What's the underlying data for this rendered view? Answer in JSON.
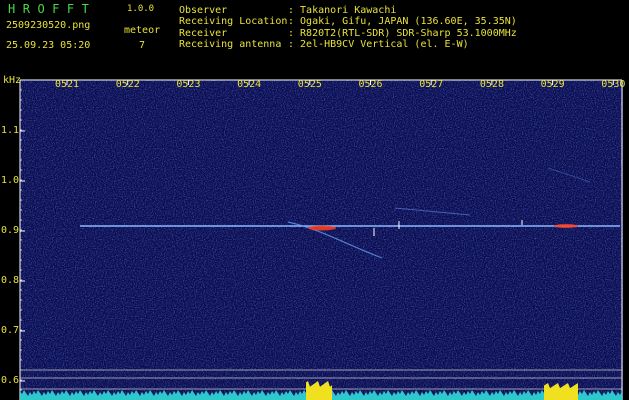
{
  "header": {
    "brand": "HROFFT",
    "version": "1.0.0",
    "filename": "2509230520.png",
    "meteor_label": "meteor",
    "datetime": "25.09.23 05:20",
    "meteor_count": "7"
  },
  "station": {
    "rows": [
      {
        "key": "Observer",
        "value": ": Takanori Kawachi"
      },
      {
        "key": "Receiving Location",
        "value": ": Ogaki, Gifu, JAPAN (136.60E, 35.35N)"
      },
      {
        "key": "Receiver",
        "value": ": R820T2(RTL-SDR) SDR-Sharp 53.1000MHz"
      },
      {
        "key": "Receiving antenna",
        "value": ": 2el-HB9CV Vertical (el. E-W)"
      }
    ]
  },
  "spectrogram": {
    "freq_unit": "kHz",
    "time_labels": [
      "0521",
      "0522",
      "0523",
      "0524",
      "0525",
      "0526",
      "0527",
      "0528",
      "0529",
      "0530"
    ],
    "freq_labels": [
      "1.1",
      "1.0",
      "0.9",
      "0.8",
      "0.7",
      "0.6"
    ],
    "colors": {
      "background": "#0c0c4a",
      "axis": "#ffffff",
      "label": "#e8e23a",
      "carrier": "#6fa8ff",
      "hot": "#ff4020",
      "level": "#2fd3d3",
      "burst": "#f0e020"
    }
  }
}
